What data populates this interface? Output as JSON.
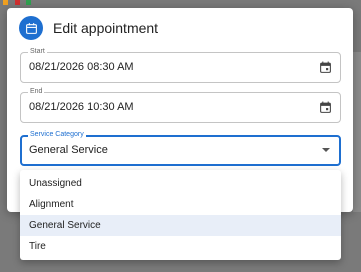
{
  "dialog": {
    "title": "Edit appointment",
    "accent_color": "#1e6fd0"
  },
  "start": {
    "label": "Start",
    "value": "08/21/2026 08:30 AM",
    "icon": "calendar-icon"
  },
  "end": {
    "label": "End",
    "value": "08/21/2026 10:30 AM",
    "icon": "calendar-icon"
  },
  "service_category": {
    "label": "Service Category",
    "value": "General Service",
    "options": [
      "Unassigned",
      "Alignment",
      "General Service",
      "Tire"
    ],
    "selected_index": 2
  }
}
